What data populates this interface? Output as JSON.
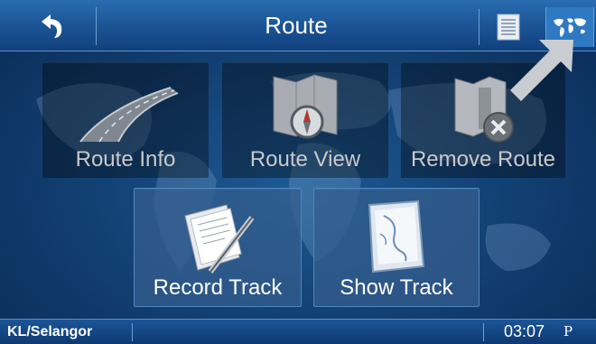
{
  "header": {
    "title": "Route"
  },
  "tiles": [
    {
      "label": "Route Info",
      "icon": "road-icon",
      "active": false
    },
    {
      "label": "Route View",
      "icon": "map-compass-icon",
      "active": false
    },
    {
      "label": "Remove Route",
      "icon": "remove-route-icon",
      "active": false
    },
    {
      "label": "Record Track",
      "icon": "notepad-pen-icon",
      "active": true
    },
    {
      "label": "Show Track",
      "icon": "track-map-icon",
      "active": true
    }
  ],
  "statusbar": {
    "region": "KL/Selangor",
    "time": "03:07",
    "ampm": "P"
  },
  "colors": {
    "background": "#134276",
    "header": "#1b5596",
    "tile_inactive_text": "#c9c9c9",
    "tile_active_text": "#ffffff"
  }
}
